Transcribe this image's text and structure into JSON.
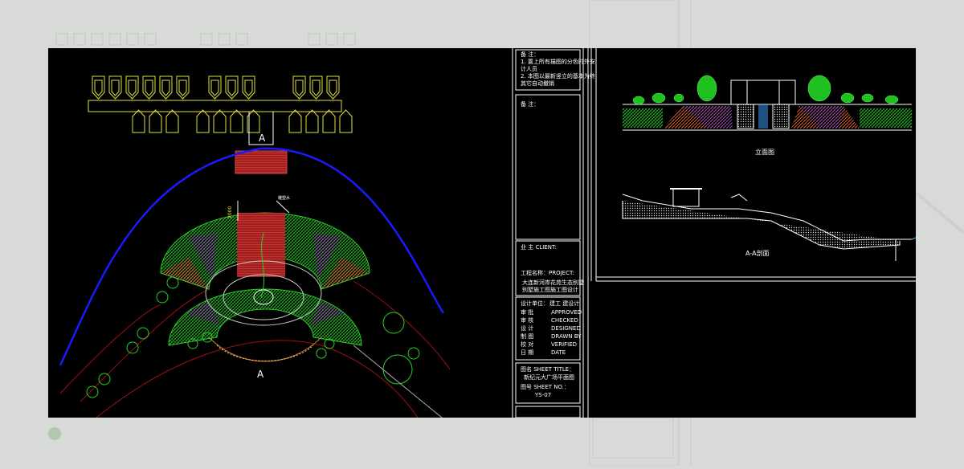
{
  "title_block": {
    "notes_header": "备 注：",
    "note_1": "1. 置上所有描图的分色时外安",
    "note_1b": "计人员",
    "note_2": "2. 本图以最新竖立的基本为终",
    "note_2b": "其它自动撤销",
    "remarks_label": "备 注：",
    "client_label": "业 主 CLIENT:",
    "project_label": "工程名称：PROJECT:",
    "project_name_1": "大连新河岸花苑生态别墅",
    "project_name_2": "别墅施工图施工图设计",
    "design_label": "设计单位：",
    "design_value": "建工 建设计",
    "rows": [
      {
        "label": "审   批",
        "value": "APPROVED"
      },
      {
        "label": "审   核",
        "value": "CHECKED"
      },
      {
        "label": "设   计",
        "value": "DESIGNED"
      },
      {
        "label": "制   图",
        "value": "DRAWN BY"
      },
      {
        "label": "校   对",
        "value": "VERIFIED"
      },
      {
        "label": "日   期",
        "value": "DATE"
      }
    ],
    "sheet_title_label": "图名 SHEET TITLE：",
    "sheet_title_value": "新纪元大广场平面图",
    "sheet_no_label": "图号 SHEET NO.：",
    "sheet_no_value": "YS-07"
  },
  "views": {
    "elevation_title": "立面图",
    "section_title": "A-A剖面",
    "section_marker": "A",
    "dimension_text": "2000",
    "callout_label": "雕塑水"
  },
  "colors": {
    "background": "#000000",
    "line_white": "#ffffff",
    "bench_yellow": "#e0e040",
    "path_blue": "#1a1aff",
    "boundary_red": "#a01010",
    "planting_green": "#20c020",
    "paving_red": "#e05020",
    "paving_purple": "#8040a0"
  }
}
